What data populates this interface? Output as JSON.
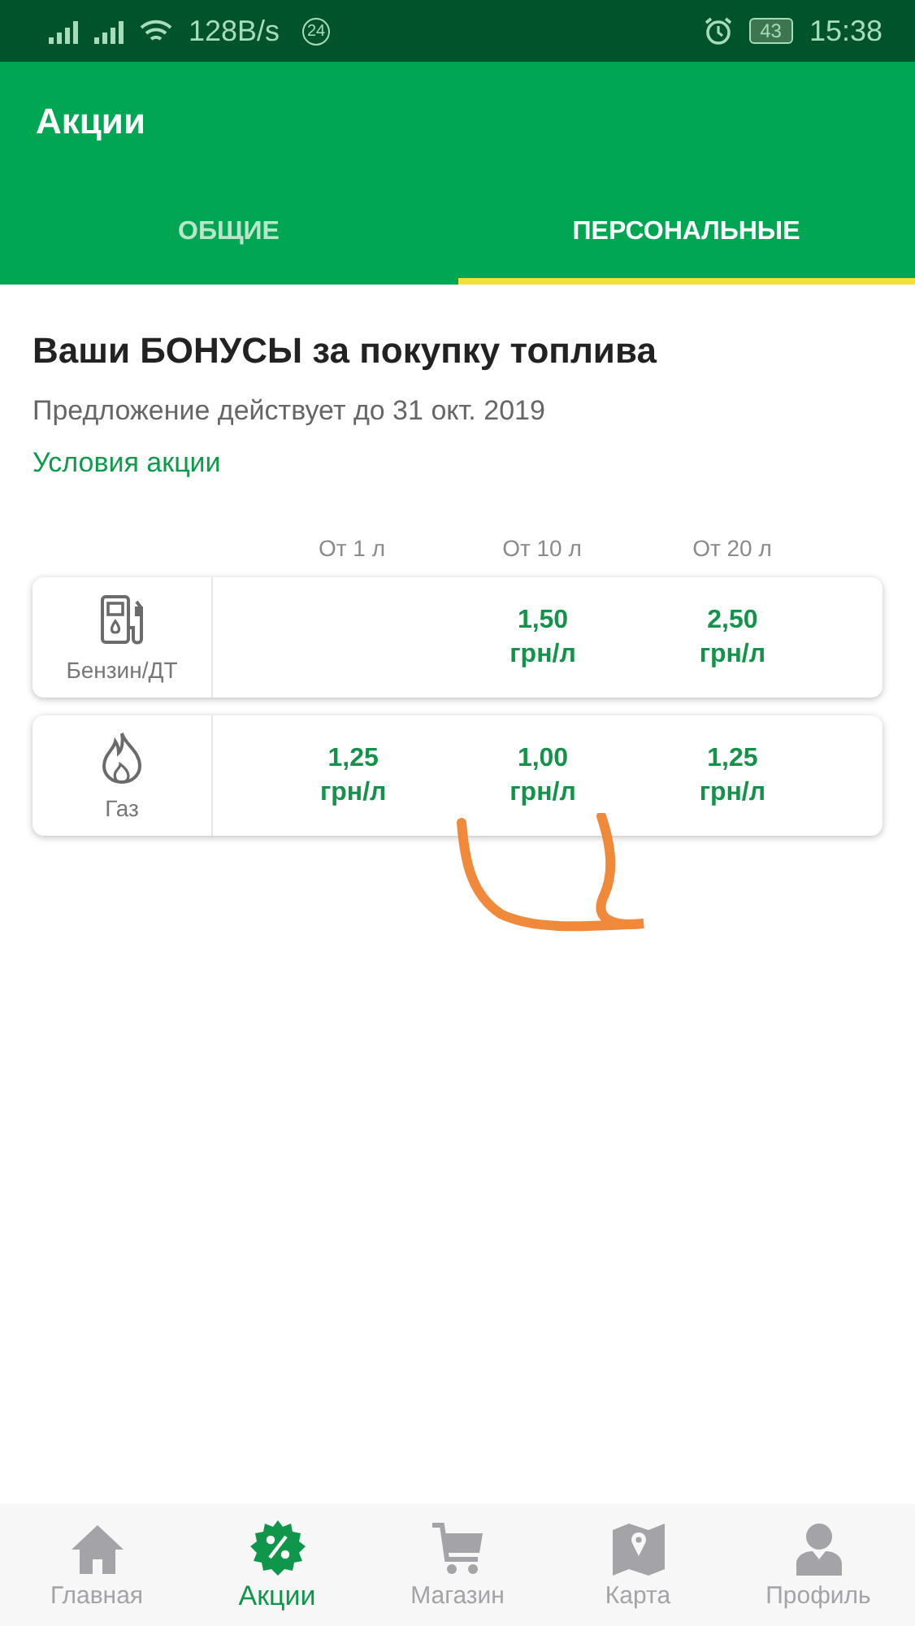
{
  "status_bar": {
    "speed": "128B/s",
    "notification_count": "24",
    "battery": "43",
    "time": "15:38"
  },
  "app_bar": {
    "title": "Акции"
  },
  "tabs": [
    {
      "label": "ОБЩИЕ",
      "selected": false
    },
    {
      "label": "ПЕРСОНАЛЬНЫЕ",
      "selected": true
    }
  ],
  "offer": {
    "title": "Ваши БОНУСЫ за покупку топлива",
    "subtitle": "Предложение действует до 31 окт. 2019",
    "link": "Условия акции"
  },
  "table": {
    "columns": [
      "От 1 л",
      "От 10 л",
      "От 20 л"
    ],
    "rows": [
      {
        "kind": "pump",
        "label": "Бензин/ДТ",
        "cells": [
          null,
          {
            "amount": "1,50",
            "unit": "грн/л"
          },
          {
            "amount": "2,50",
            "unit": "грн/л"
          }
        ]
      },
      {
        "kind": "flame",
        "label": "Газ",
        "cells": [
          {
            "amount": "1,25",
            "unit": "грн/л"
          },
          {
            "amount": "1,00",
            "unit": "грн/л"
          },
          {
            "amount": "1,25",
            "unit": "грн/л"
          }
        ]
      }
    ]
  },
  "bottom_nav": [
    {
      "kind": "home",
      "label": "Главная",
      "selected": false
    },
    {
      "kind": "promo",
      "label": "Акции",
      "selected": true
    },
    {
      "kind": "cart",
      "label": "Магазин",
      "selected": false
    },
    {
      "kind": "map",
      "label": "Карта",
      "selected": false
    },
    {
      "kind": "profile",
      "label": "Профиль",
      "selected": false
    }
  ]
}
